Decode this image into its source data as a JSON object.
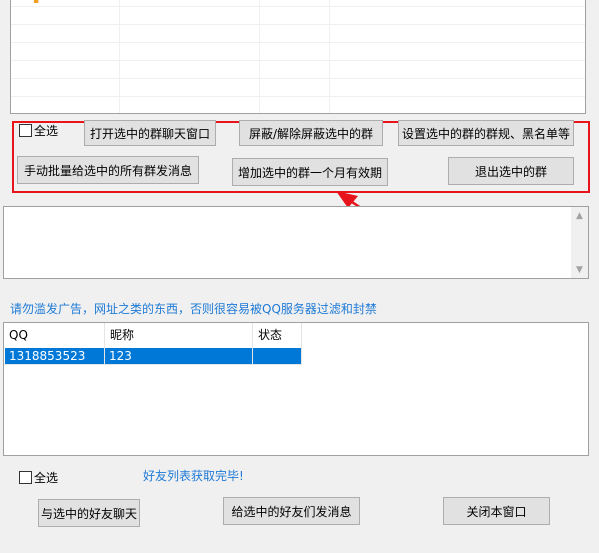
{
  "group_section": {
    "select_all_label": "全选",
    "buttons": {
      "open_chat": "打开选中的群聊天窗口",
      "block_toggle": "屏蔽/解除屏蔽选中的群",
      "set_rules": "设置选中的群的群规、黑名单等",
      "bulk_message": "手动批量给选中的所有群发消息",
      "extend_month": "增加选中的群一个月有效期",
      "exit_group": "退出选中的群"
    }
  },
  "message_area": {
    "value": ""
  },
  "warning_text": "请勿滥发广告，网址之类的东西，否则很容易被QQ服务器过滤和封禁",
  "friend_list": {
    "columns": [
      "QQ",
      "昵称",
      "状态"
    ],
    "rows": [
      {
        "qq": "1318853523",
        "nickname": "123",
        "status": ""
      }
    ]
  },
  "friend_section": {
    "select_all_label": "全选",
    "status_text": "好友列表获取完毕!",
    "buttons": {
      "chat": "与选中的好友聊天",
      "send_message": "给选中的好友们发消息",
      "close": "关闭本窗口"
    }
  },
  "colors": {
    "highlight_frame": "#e8141c",
    "arrow": "#e8141c",
    "selection": "#0078d7",
    "info_text": "#1e7ad6"
  }
}
